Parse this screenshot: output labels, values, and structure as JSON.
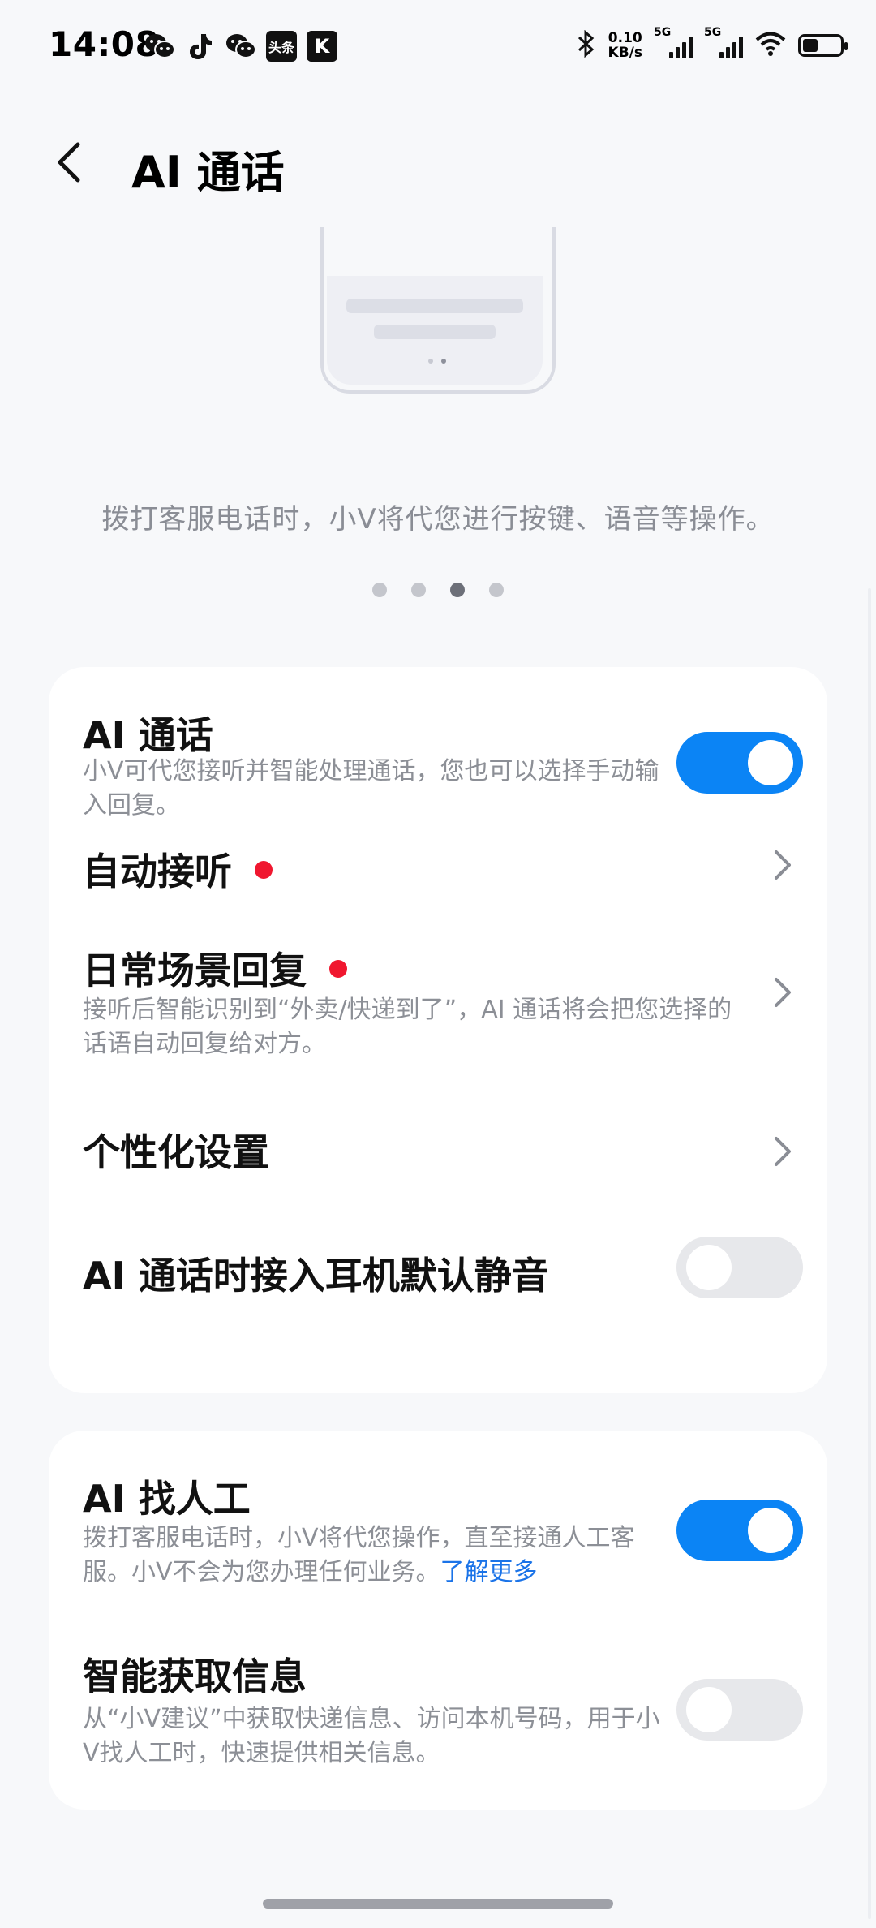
{
  "status_bar": {
    "time": "14:08",
    "notification_icons": [
      "wechat-icon",
      "tiktok-icon",
      "wechat-icon",
      "toutiao-icon",
      "kuaishou-icon"
    ],
    "toutiao_label": "头条",
    "kuai_label": "K",
    "network_speed_value": "0.10",
    "network_speed_unit": "KB/s",
    "sim1_tag": "5G",
    "sim2_tag": "5G"
  },
  "header": {
    "title": "AI 通话"
  },
  "intro": {
    "text": "拨打客服电话时，小Ⅴ将代您进行按键、语音等操作。",
    "pages": 4,
    "active_page": 3
  },
  "card1": {
    "ai_call": {
      "title": "AI 通话",
      "subtitle": "小Ⅴ可代您接听并智能处理通话，您也可以选择手动输入回复。",
      "enabled": true
    },
    "auto_answer": {
      "title": "自动接听"
    },
    "daily_reply": {
      "title": "日常场景回复",
      "subtitle": "接听后智能识别到“外卖/快递到了”，AI 通话将会把您选择的话语自动回复给对方。"
    },
    "personalize": {
      "title": "个性化设置"
    },
    "headset_mute": {
      "title": "AI 通话时接入耳机默认静音",
      "enabled": false
    }
  },
  "card2": {
    "find_human": {
      "title": "AI 找人工",
      "subtitle": "拨打客服电话时，小Ⅴ将代您操作，直至接通人工客服。小Ⅴ不会为您办理任何业务。",
      "link": "了解更多",
      "enabled": true
    },
    "smart_info": {
      "title": "智能获取信息",
      "subtitle": "从“小Ⅴ建议”中获取快递信息、访问本机号码，用于小Ⅴ找人工时，快速提供相关信息。",
      "enabled": false
    }
  },
  "colors": {
    "accent": "#0b84f5",
    "badge_red": "#f0172f",
    "link": "#1a73e8"
  }
}
